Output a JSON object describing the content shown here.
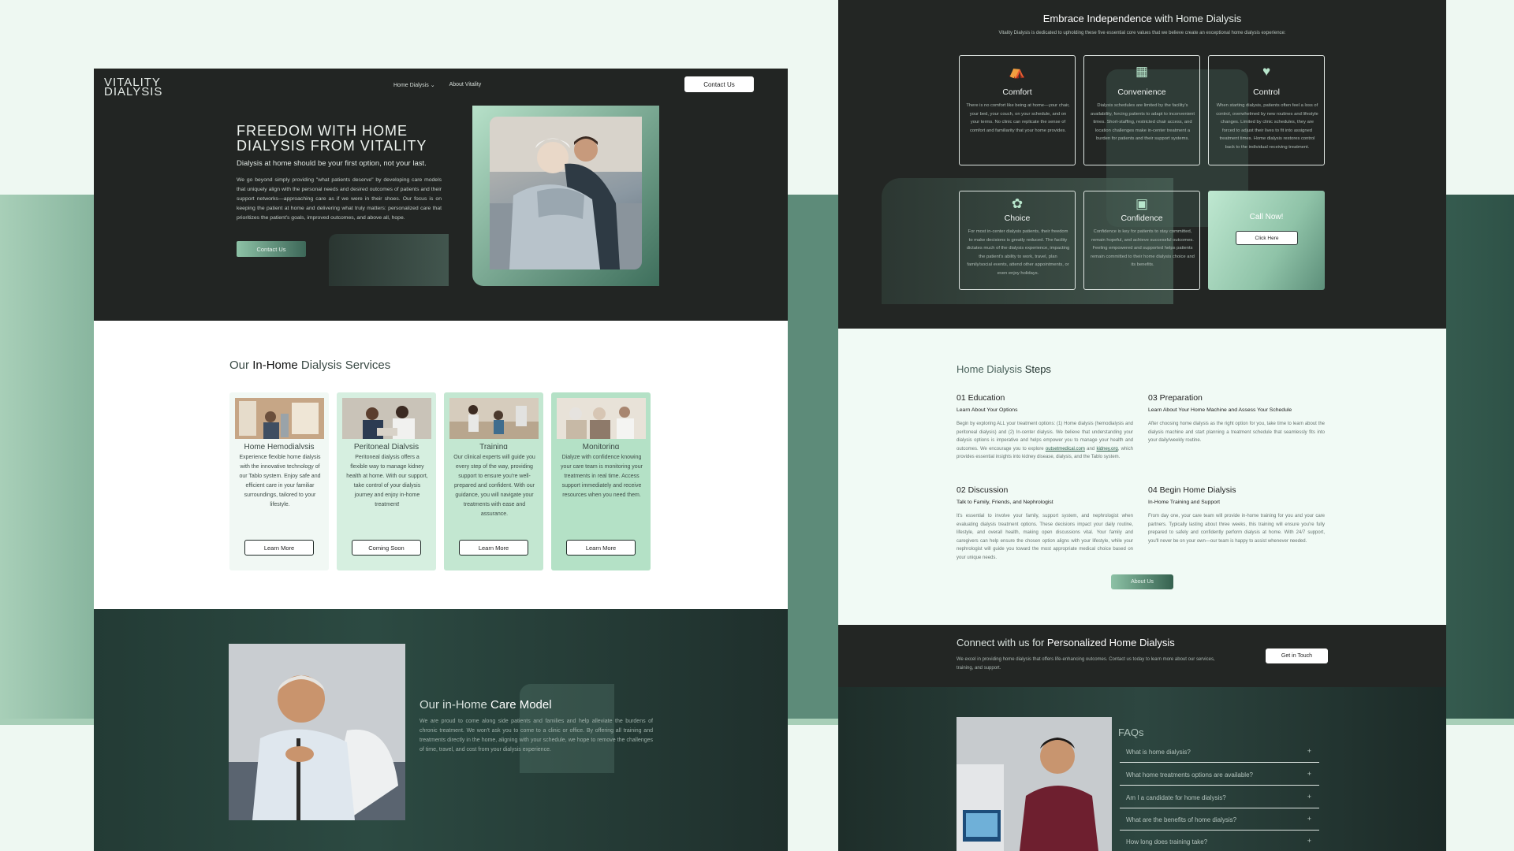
{
  "left": {
    "logo": {
      "line1": "VITALITY",
      "line2": "DIALYSIS"
    },
    "nav": {
      "home_dialysis": "Home Dialysis",
      "about": "About Vitality",
      "contact": "Contact Us"
    },
    "hero": {
      "title": "FREEDOM WITH HOME DIALYSIS FROM VITALITY",
      "subtitle": "Dialysis at home should be your first option, not your last.",
      "body": "We go beyond simply providing \"what patients deserve\" by developing care models that uniquely align with the personal needs and desired outcomes of patients and their support networks—approaching care as if we were in their shoes. Our focus is on keeping the patient at home and delivering what truly matters: personalized care that prioritizes the patient's goals, improved outcomes, and above all, hope.",
      "button": "Contact Us"
    },
    "services": {
      "title_pre": "Our ",
      "title_bold": "In-Home",
      "title_post": " Dialysis Services",
      "items": [
        {
          "name": "Home Hemodialysis",
          "desc": "Experience flexible home dialysis with the innovative technology of our Tablo system. Enjoy safe and efficient care in your familiar surroundings, tailored to your lifestyle.",
          "button": "Learn More"
        },
        {
          "name": "Peritoneal Dialysis",
          "desc": "Peritoneal dialysis offers a flexible way to manage kidney health at home. With our support, take control of your dialysis journey and enjoy in-home treatment!",
          "button": "Coming Soon"
        },
        {
          "name": "Training",
          "desc": "Our clinical experts will guide you every step of the way, providing support to ensure you're well-prepared and confident. With our guidance, you will navigate your treatments with ease and assurance.",
          "button": "Learn More"
        },
        {
          "name": "Monitoring",
          "desc": "Dialyze with confidence knowing your care team is monitoring your treatments in real time. Access support immediately and receive resources when you need them.",
          "button": "Learn More"
        }
      ]
    },
    "care": {
      "title_pre": "Our in-Home ",
      "title_bold": "Care Model",
      "body": "We are proud to come along side patients and families and help alleviate the burdens of chronic treatment. We won't ask you to come to a clinic or office. By offering all training and treatments directly in the home, aligning with your schedule, we hope to remove the challenges of time, travel, and cost from your dialysis experience."
    }
  },
  "right": {
    "values": {
      "title_bold": "Embrace Independence",
      "title_post": " with Home Dialysis",
      "subtitle": "Vitality Dialysis is dedicated to upholding these five essential core values that we believe create an exceptional home dialysis experience:",
      "cards": [
        {
          "icon": "sofa-icon",
          "glyph": "⛺",
          "name": "Comfort",
          "desc": "There is no comfort like being at home—your chair, your bed, your couch, on your schedule, and on your terms. No clinic can replicate the sense of comfort and familiarity that your home provides."
        },
        {
          "icon": "building-icon",
          "glyph": "▦",
          "name": "Convenience",
          "desc": "Dialysis schedules are limited by the facility's availability, forcing patients to adapt to inconvenient times. Short-staffing, restricted chair access, and location challenges make in-center treatment a burden for patients and their support systems."
        },
        {
          "icon": "heart-hand-icon",
          "glyph": "♥",
          "name": "Control",
          "desc": "When starting dialysis, patients often feel a loss of control, overwhelmed by new routines and lifestyle changes. Limited by clinic schedules, they are forced to adjust their lives to fit into assigned treatment times. Home dialysis restores control back to the individual receiving treatment."
        },
        {
          "icon": "choice-icon",
          "glyph": "✿",
          "name": "Choice",
          "desc": "For most in-center dialysis patients, their freedom to make decisions is greatly reduced. The facility dictates much of the dialysis experience, impacting the patient's ability to work, travel, plan family/social events, attend other appointments, or even enjoy holidays."
        },
        {
          "icon": "monitor-icon",
          "glyph": "▣",
          "name": "Confidence",
          "desc": "Confidence is key for patients to stay committed, remain hopeful, and achieve successful outcomes. Feeling empowered and supported helps patients remain committed to their home dialysis choice and its benefits."
        }
      ],
      "call": {
        "title": "Call Now!",
        "button": "Click Here"
      }
    },
    "steps": {
      "title_pre": "Home Dialysis ",
      "title_bold": "Steps",
      "items": [
        {
          "heading": "01 Education",
          "sub": "Learn About Your Options",
          "body_a": "Begin by exploring ALL your treatment options: (1) Home dialysis (hemodialysis and peritoneal dialysis) and (2) In-center dialysis. We believe that understanding your dialysis options is imperative and helps empower you to manage your health and outcomes. We encourage you to explore ",
          "link1": "outsetmedical.com",
          "mid": " and ",
          "link2": "kidney.org",
          "body_b": ", which provides essential insights into kidney disease, dialysis, and the Tablo system."
        },
        {
          "heading": "02 Discussion",
          "sub": "Talk to Family, Friends, and Nephrologist",
          "body": "It's essential to involve your family, support system, and nephrologist when evaluating dialysis treatment options. These decisions impact your daily routine, lifestyle, and overall health, making open discussions vital. Your family and caregivers can help ensure the chosen option aligns with your lifestyle, while your nephrologist will guide you toward the most appropriate medical choice based on your unique needs."
        },
        {
          "heading": "03 Preparation",
          "sub": "Learn About Your Home Machine and Assess Your Schedule",
          "body": "After choosing home dialysis as the right option for you, take time to learn about the dialysis machine and start planning a treatment schedule that seamlessly fits into your daily/weekly routine."
        },
        {
          "heading": "04 Begin Home Dialysis",
          "sub": "In-Home Training and Support",
          "body": "From day one, your care team will provide in-home training for you and your care partners. Typically lasting about three weeks, this training will ensure you're fully prepared to safely and confidently perform dialysis at home. With 24/7 support, you'll never be on your own—our team is happy to assist whenever needed."
        }
      ],
      "button": "About Us"
    },
    "connect": {
      "title_pre": "Connect with us for ",
      "title_bold": "Personalized Home Dialysis",
      "body": "We excel in providing home dialysis that offers life-enhancing outcomes. Contact us today to learn more about our services, training, and support.",
      "button": "Get in Touch"
    },
    "faq": {
      "title": "FAQs",
      "items": [
        "What is home dialysis?",
        "What home treatments options are available?",
        "Am I a candidate for home dialysis?",
        "What are the benefits of home dialysis?",
        "How long does training take?"
      ],
      "plus": "+"
    }
  }
}
